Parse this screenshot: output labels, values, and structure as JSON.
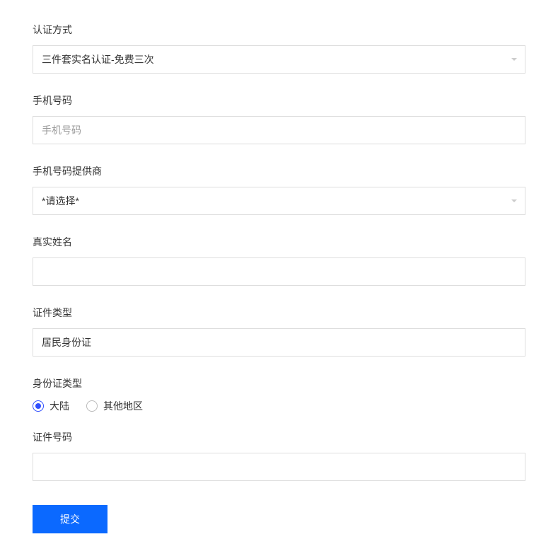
{
  "auth_method": {
    "label": "认证方式",
    "selected": "三件套实名认证-免费三次"
  },
  "phone": {
    "label": "手机号码",
    "placeholder": "手机号码",
    "value": ""
  },
  "provider": {
    "label": "手机号码提供商",
    "selected": "*请选择*"
  },
  "real_name": {
    "label": "真实姓名",
    "value": ""
  },
  "id_type": {
    "label": "证件类型",
    "value": "居民身份证"
  },
  "id_region": {
    "label": "身份证类型",
    "options": [
      {
        "label": "大陆",
        "checked": true
      },
      {
        "label": "其他地区",
        "checked": false
      }
    ]
  },
  "id_number": {
    "label": "证件号码",
    "value": ""
  },
  "submit": {
    "label": "提交"
  }
}
